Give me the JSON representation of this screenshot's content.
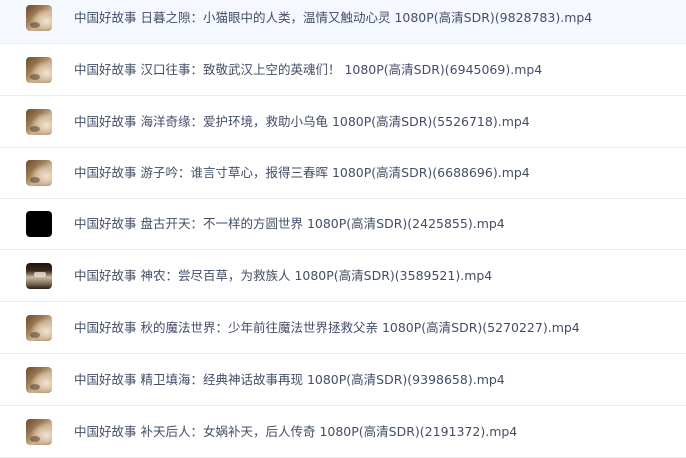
{
  "files": [
    {
      "name": "中国好故事 日暮之隙：小猫眼中的人类，温情又触动心灵 1080P(高清SDR)(9828783).mp4",
      "thumbnail": "video-thumbnail"
    },
    {
      "name": "中国好故事 汉口往事：致敬武汉上空的英魂们！ 1080P(高清SDR)(6945069).mp4",
      "thumbnail": "video-thumbnail"
    },
    {
      "name": "中国好故事 海洋奇缘：爱护环境，救助小乌龟 1080P(高清SDR)(5526718).mp4",
      "thumbnail": "video-thumbnail"
    },
    {
      "name": "中国好故事 游子吟：谁言寸草心，报得三春晖 1080P(高清SDR)(6688696).mp4",
      "thumbnail": "video-thumbnail"
    },
    {
      "name": "中国好故事 盘古开天：不一样的方圆世界 1080P(高清SDR)(2425855).mp4",
      "thumbnail": "black-thumbnail"
    },
    {
      "name": "中国好故事 神农：尝尽百草，为救族人 1080P(高清SDR)(3589521).mp4",
      "thumbnail": "scene-thumbnail"
    },
    {
      "name": "中国好故事 秋的魔法世界：少年前往魔法世界拯救父亲 1080P(高清SDR)(5270227).mp4",
      "thumbnail": "video-thumbnail"
    },
    {
      "name": "中国好故事 精卫填海：经典神话故事再现 1080P(高清SDR)(9398658).mp4",
      "thumbnail": "video-thumbnail"
    },
    {
      "name": "中国好故事 补天后人：女娲补天，后人传奇 1080P(高清SDR)(2191372).mp4",
      "thumbnail": "video-thumbnail"
    }
  ]
}
